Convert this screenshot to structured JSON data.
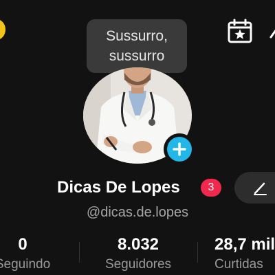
{
  "tooltip": {
    "line1": "Sussurro,",
    "line2": "sussurro"
  },
  "profile": {
    "display_name": "Dicas De Lopes",
    "notification_count": "3",
    "username": "@dicas.de.lopes"
  },
  "stats": [
    {
      "value": "0",
      "label": "Seguindo"
    },
    {
      "value": "8.032",
      "label": "Seguidores"
    },
    {
      "value": "28,7 mil",
      "label": "Curtidas"
    }
  ],
  "icons": {
    "top_left": "status-circle-icon",
    "calendar": "calendar-star-icon",
    "add": "plus-icon",
    "edit": "pencil-icon"
  },
  "colors": {
    "background": "#121212",
    "accent": "#22b7e8",
    "badge": "#f0284e",
    "tooltip": "#3a3a3a"
  }
}
